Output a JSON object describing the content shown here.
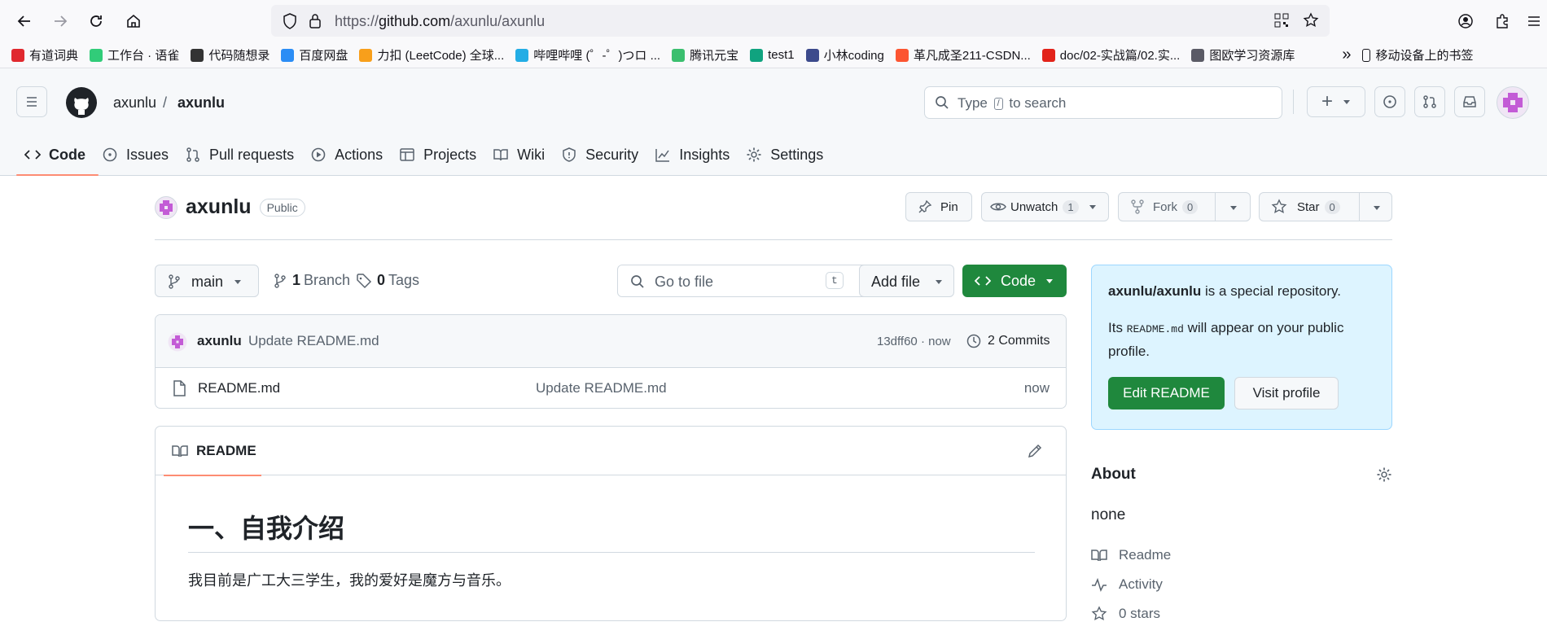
{
  "browser": {
    "url_prefix": "https://",
    "url_host": "github.com",
    "url_path": "/axunlu/axunlu",
    "bookmarks": [
      {
        "label": "有道词典",
        "color": "#e0282e"
      },
      {
        "label": "工作台 · 语雀",
        "color": "#31cc79"
      },
      {
        "label": "代码随想录",
        "color": "#333333"
      },
      {
        "label": "百度网盘",
        "color": "#2b8df5"
      },
      {
        "label": "力扣 (LeetCode) 全球...",
        "color": "#f89f1b"
      },
      {
        "label": "哔哩哔哩 (゜-゜)つロ ...",
        "color": "#23ade5"
      },
      {
        "label": "腾讯元宝",
        "color": "#3bbf6f"
      },
      {
        "label": "test1",
        "color": "#10a37f"
      },
      {
        "label": "小林coding",
        "color": "#3c4a8c"
      },
      {
        "label": "革凡成圣211-CSDN...",
        "color": "#fc5531"
      },
      {
        "label": "doc/02-实战篇/02.实...",
        "color": "#e2231a"
      },
      {
        "label": "图欧学习资源库",
        "color": "#5b5b66"
      }
    ],
    "overflow_label": "»",
    "mobile_bookmarks": "移动设备上的书签"
  },
  "header": {
    "owner": "axunlu",
    "separator": "/",
    "repo": "axunlu",
    "search_prefix": "Type",
    "search_key": "/",
    "search_suffix": "to search",
    "plus_label": "+"
  },
  "tabs": [
    {
      "label": "Code",
      "icon": "code-icon"
    },
    {
      "label": "Issues",
      "icon": "issue-icon"
    },
    {
      "label": "Pull requests",
      "icon": "pull-request-icon"
    },
    {
      "label": "Actions",
      "icon": "play-icon"
    },
    {
      "label": "Projects",
      "icon": "table-icon"
    },
    {
      "label": "Wiki",
      "icon": "book-icon"
    },
    {
      "label": "Security",
      "icon": "shield-icon"
    },
    {
      "label": "Insights",
      "icon": "graph-icon"
    },
    {
      "label": "Settings",
      "icon": "gear-icon"
    }
  ],
  "repo": {
    "name": "axunlu",
    "visibility": "Public",
    "pin_label": "Pin",
    "watch_label": "Unwatch",
    "watch_count": "1",
    "fork_label": "Fork",
    "fork_count": "0",
    "star_label": "Star",
    "star_count": "0"
  },
  "filebar": {
    "branch": "main",
    "branch_count": "1",
    "branch_label": "Branch",
    "tag_count": "0",
    "tag_label": "Tags",
    "goto_placeholder": "Go to file",
    "goto_key": "t",
    "add_file": "Add file",
    "code_label": "Code"
  },
  "commit": {
    "author": "axunlu",
    "message": "Update README.md",
    "hash_time": "13dff60 · now",
    "commits_label": "2 Commits"
  },
  "files": [
    {
      "name": "README.md",
      "message": "Update README.md",
      "time": "now"
    }
  ],
  "readme": {
    "tab_label": "README",
    "heading": "一、自我介绍",
    "paragraph": "我目前是广工大三学生，我的爱好是魔方与音乐。"
  },
  "special": {
    "repo_name": "axunlu/axunlu",
    "line1_rest": " is a special repository.",
    "line2_prefix": "Its ",
    "line2_code": "README.md",
    "line2_rest": " will appear on your public profile.",
    "edit_button": "Edit README",
    "visit_button": "Visit profile"
  },
  "about": {
    "title": "About",
    "description": "none",
    "links": [
      "Readme",
      "Activity",
      "0 stars"
    ]
  },
  "colors": {
    "primary_green": "#1f883d",
    "tab_underline": "#fd8c73",
    "special_bg": "#ddf4ff",
    "avatar_purple": "#c35bd6"
  }
}
